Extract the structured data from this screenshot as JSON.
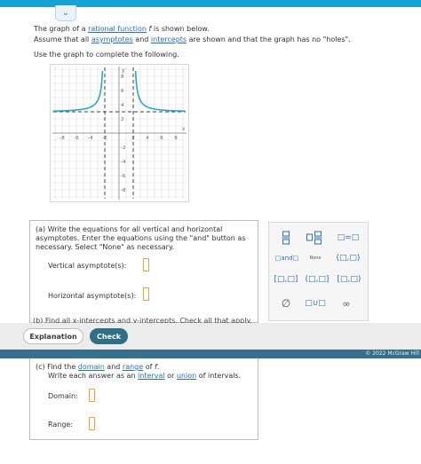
{
  "header": {
    "collapse_icon": "chevron-down-icon"
  },
  "problem": {
    "line1_a": "The graph of a ",
    "line1_link": "rational function",
    "line1_var": "f",
    "line1_b": " is shown below.",
    "line2_a": "Assume that all ",
    "line2_link1": "asymptotes",
    "line2_mid": " and ",
    "line2_link2": "intercepts",
    "line2_b": " are shown and that the graph has no \"holes\".",
    "instruction": "Use the graph to complete the following."
  },
  "graph": {
    "x_ticks": [
      "-8",
      "-6",
      "-4",
      "-2",
      "2",
      "4",
      "6",
      "8"
    ],
    "y_ticks": [
      "8",
      "6",
      "4",
      "2",
      "-2",
      "-4",
      "-6",
      "-8"
    ],
    "x_axis_label": "x",
    "y_axis_label": "y",
    "curve_color": "#2aa7c8"
  },
  "part_a": {
    "text": "(a) Write the equations for all vertical and horizontal asymptotes. Enter the equations using the \"and\" button as necessary. Select \"None\" as necessary.",
    "vertical_label": "Vertical asymptote(s):",
    "horizontal_label": "Horizontal asymptote(s):",
    "vertical_value": "",
    "horizontal_value": ""
  },
  "part_b": {
    "text": "(b) Find all x-intercepts and y-intercepts. Check all that apply."
  },
  "math_palette": {
    "fraction": "□/□",
    "mixed": "□□/□",
    "equals": "□=□",
    "and": "□and□",
    "none": "None",
    "open_open": "(□,□)",
    "closed_closed": "[□,□]",
    "open_closed": "(□,□]",
    "closed_open": "[□,□)",
    "empty_set": "∅",
    "union": "□∪□",
    "infinity": "∞"
  },
  "actions": {
    "explanation": "Explanation",
    "check": "Check"
  },
  "footer": {
    "copyright": "© 2022 McGraw Hill"
  },
  "part_c": {
    "line1_a": "(c) Find the ",
    "line1_link1": "domain",
    "line1_mid": " and ",
    "line1_link2": "range",
    "line1_b": " of ",
    "line1_var": "f",
    "line1_end": ".",
    "line2_a": "Write each answer as an ",
    "line2_link1": "interval",
    "line2_mid": " or ",
    "line2_link2": "union",
    "line2_b": " of intervals.",
    "domain_label": "Domain:",
    "range_label": "Range:",
    "domain_value": "",
    "range_value": ""
  }
}
